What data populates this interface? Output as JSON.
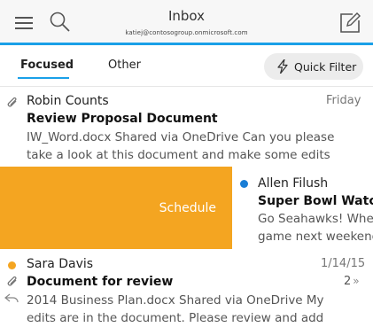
{
  "header": {
    "title": "Inbox",
    "account": "katiej@contosogroup.onmicrosoft.com",
    "menu_icon": "hamburger-icon",
    "search_icon": "search-icon",
    "compose_icon": "compose-icon",
    "accent_color": "#1aa0e8"
  },
  "tabs": {
    "focused_label": "Focused",
    "other_label": "Other",
    "quick_filter_label": "Quick Filter",
    "quick_filter_icon": "lightning-icon"
  },
  "mails": [
    {
      "sender": "Robin Counts",
      "date": "Friday",
      "subject": "Review Proposal Document",
      "preview_line1": "IW_Word.docx Shared via OneDrive Can you please",
      "preview_line2": "take a look at this document and make some edits",
      "has_attachment": true
    },
    {
      "sender": "Allen Filush",
      "subject": "Super Bowl Watch",
      "preview_line1": "Go Seahawks! Whe",
      "preview_line2": "game next weekenc",
      "unread": true,
      "swipe_action": "Schedule",
      "swipe_color": "#f4a521"
    },
    {
      "sender": "Sara Davis",
      "date": "1/14/15",
      "subject": "Document for review",
      "thread_count": "2",
      "preview_line1": "2014 Business Plan.docx Shared via OneDrive  My",
      "preview_line2": "edits are in the document. Please review and add",
      "has_attachment": true,
      "replied": true,
      "flag_color": "#f4a521"
    }
  ]
}
